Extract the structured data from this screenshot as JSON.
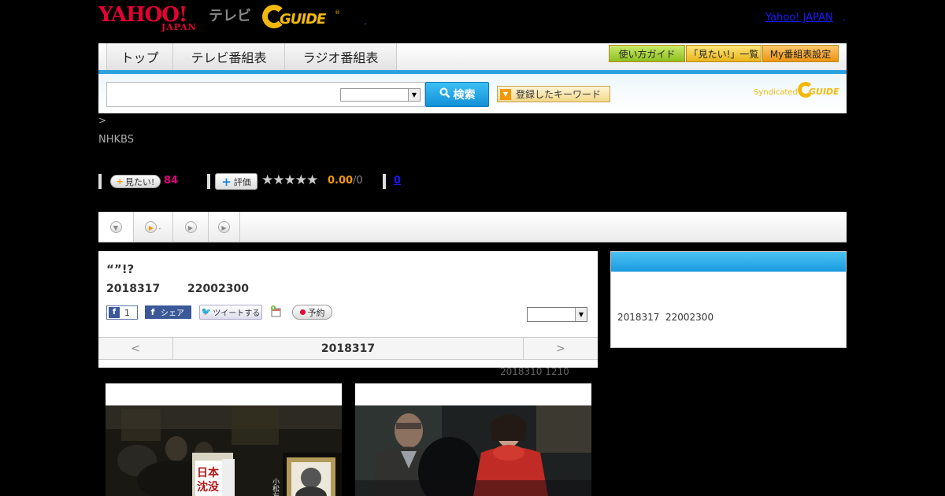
{
  "header": {
    "yahoo_logo_main": "YAHOO!",
    "yahoo_logo_sub": "JAPAN",
    "tv_label": "テレビ",
    "gguide_logo": "GUIDE",
    "gguide_reg": "®",
    "dot": ".",
    "yahoo_japan_link": "Yahoo! JAPAN",
    "yahoo_japan_dot": "."
  },
  "nav": {
    "tabs": [
      {
        "label": "トップ"
      },
      {
        "label": "テレビ番組表"
      },
      {
        "label": "ラジオ番組表"
      }
    ],
    "right_buttons": [
      {
        "label": "使い方ガイド",
        "color": "#a3d135"
      },
      {
        "label": "「見たい!」一覧",
        "color": "#f2c230"
      },
      {
        "label": "My番組表設定",
        "color": "#f5a523"
      }
    ]
  },
  "search": {
    "input_value": "",
    "select_value": "",
    "button_label": "検索",
    "keyword_button_label": "登録したキーワード",
    "syndicated_label": "Syndicated",
    "syndicated_logo": "GUIDE"
  },
  "breadcrumb": {
    "text": ">"
  },
  "channel": {
    "name": "NHKBS"
  },
  "stats": {
    "mitai_label": "見たい!",
    "mitai_count": "84",
    "hyoka_label": "評価",
    "stars": "★★★★★",
    "score": "0.00",
    "score_den": "/0",
    "review_count": "0"
  },
  "subtabs": [
    {
      "label": ""
    },
    {
      "label": "."
    },
    {
      "label": ""
    },
    {
      "label": ""
    }
  ],
  "program": {
    "title": "“”!?",
    "date": "2018317",
    "time": "22002300",
    "fb_count": "1",
    "fb_share_label": "シェア",
    "tweet_label": "ツイートする",
    "reserve_label": "予約",
    "select_value": ""
  },
  "date_nav": {
    "prev": "<",
    "current": "2018317",
    "next": ">"
  },
  "updated": "2018310  1210",
  "sidebar": {
    "date": "2018317",
    "time": "22002300"
  },
  "thumb_left": {
    "sign_1": "日本",
    "sign_2": "沈没",
    "sign_3": "小松左京"
  },
  "colors": {
    "accent_blue": "#2aa2e0",
    "yahoo_red": "#e60033",
    "gguide_yellow": "#f2b90c",
    "mitai_pink": "#e4007f",
    "score_orange": "#f39800"
  }
}
